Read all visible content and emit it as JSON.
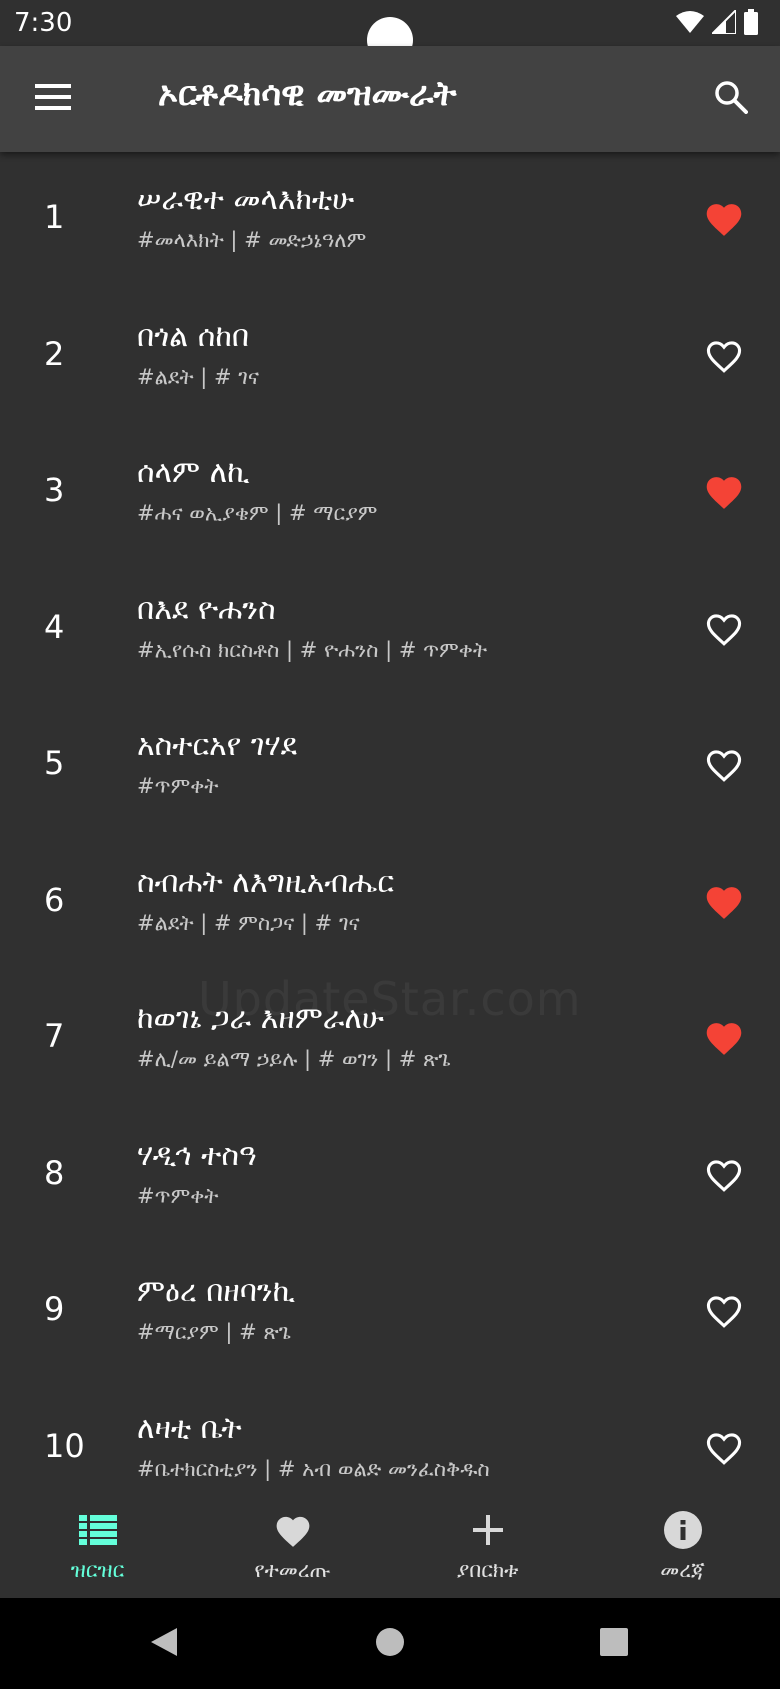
{
  "status_bar": {
    "time": "7:30"
  },
  "app_bar": {
    "title": "ኦርቶዶክሳዊ መዝሙራት",
    "menu_icon": "hamburger-menu-icon",
    "search_icon": "search-icon"
  },
  "colors": {
    "background": "#303030",
    "app_bar": "#424242",
    "favorite_active": "#f44336",
    "accent": "#64ffda"
  },
  "songs": [
    {
      "number": "1",
      "title": "ሠራዊተ መላእክቲሁ",
      "tags": "#መላእክት | # መድኃኔዓለም",
      "favorite": true
    },
    {
      "number": "2",
      "title": "በጎል ሰከበ",
      "tags": "#ልደት | # ገና",
      "favorite": false
    },
    {
      "number": "3",
      "title": "ሰላም ለኪ",
      "tags": "#ሐና ወኢያቄም | # ማርያም",
      "favorite": true
    },
    {
      "number": "4",
      "title": "በእደ ዮሐንስ",
      "tags": "#ኢየሱስ ክርስቶስ | # ዮሐንስ | # ጥምቀት",
      "favorite": false
    },
    {
      "number": "5",
      "title": "አስተርአየ ገሃደ",
      "tags": "#ጥምቀት",
      "favorite": false
    },
    {
      "number": "6",
      "title": "ስብሐት ለእግዚአብሔር",
      "tags": "#ልደት | # ምስጋና | # ገና",
      "favorite": true
    },
    {
      "number": "7",
      "title": "ከወገኔ ጋራ እዘምራለሁ",
      "tags": "#ሊ/መ ይልማ ኃይሉ | # ወገን | # ጽጌ",
      "favorite": true
    },
    {
      "number": "8",
      "title": "ሃዲኅ ተስዓ",
      "tags": "#ጥምቀት",
      "favorite": false
    },
    {
      "number": "9",
      "title": "ምዕረ በዘባንኪ",
      "tags": "#ማርያም | # ጽጌ",
      "favorite": false
    },
    {
      "number": "10",
      "title": "ለዛቲ ቤት",
      "tags": "#ቤተክርስቲያን | # አብ ወልድ መንፈስቅዱስ",
      "favorite": false
    }
  ],
  "watermark": "UpdateStar.com",
  "bottom_nav": [
    {
      "label": "ዝርዝር",
      "icon": "list-icon",
      "active": true
    },
    {
      "label": "የተመረጡ",
      "icon": "heart-icon",
      "active": false
    },
    {
      "label": "ያበርክቱ",
      "icon": "plus-icon",
      "active": false
    },
    {
      "label": "መረጃ",
      "icon": "info-icon",
      "active": false
    }
  ],
  "system_nav": {
    "back_icon": "back-triangle-icon",
    "home_icon": "home-circle-icon",
    "recents_icon": "recents-square-icon"
  }
}
